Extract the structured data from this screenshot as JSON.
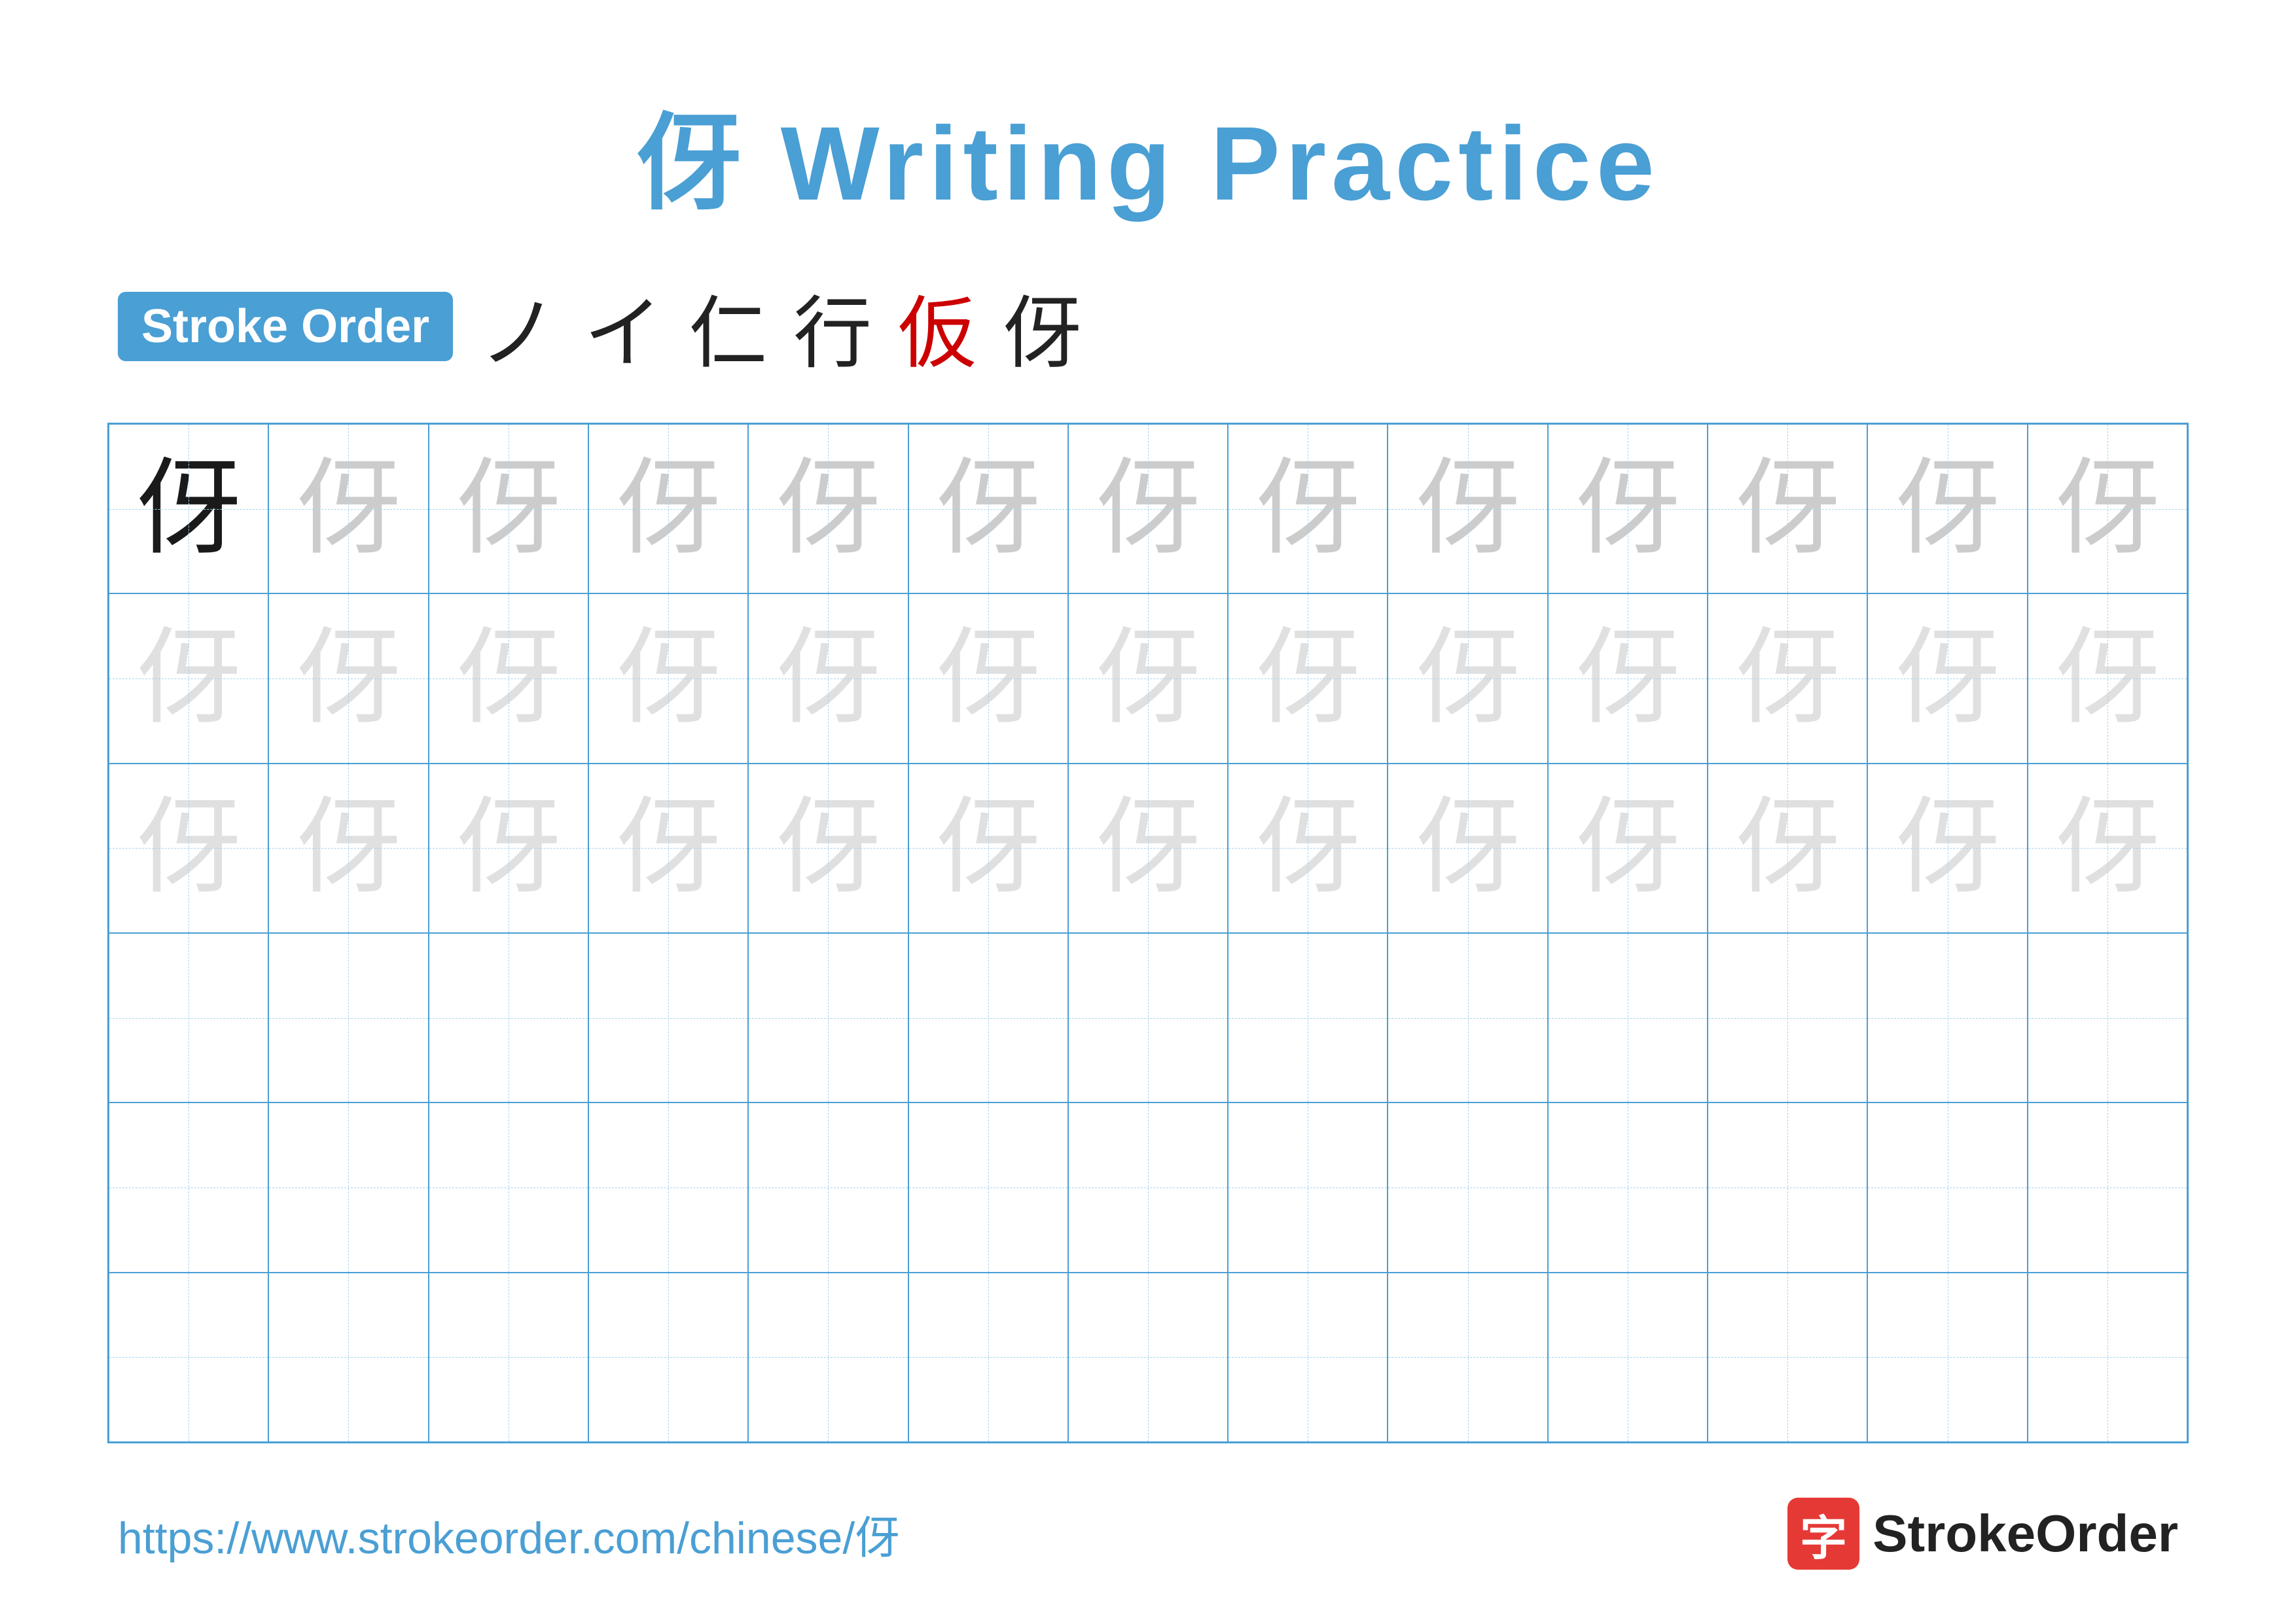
{
  "title": {
    "char": "伢",
    "text": "Writing Practice",
    "full": "伢 Writing Practice"
  },
  "stroke_order": {
    "badge_label": "Stroke Order",
    "strokes": [
      "ノ",
      "イ",
      "仁",
      "行",
      "仮",
      "伢"
    ]
  },
  "grid": {
    "rows": 6,
    "cols": 13,
    "char": "伢",
    "cells": [
      {
        "row": 0,
        "col": 0,
        "style": "dark"
      },
      {
        "row": 0,
        "col": 1,
        "style": "medium"
      },
      {
        "row": 0,
        "col": 2,
        "style": "medium"
      },
      {
        "row": 0,
        "col": 3,
        "style": "medium"
      },
      {
        "row": 0,
        "col": 4,
        "style": "medium"
      },
      {
        "row": 0,
        "col": 5,
        "style": "medium"
      },
      {
        "row": 0,
        "col": 6,
        "style": "medium"
      },
      {
        "row": 0,
        "col": 7,
        "style": "medium"
      },
      {
        "row": 0,
        "col": 8,
        "style": "medium"
      },
      {
        "row": 0,
        "col": 9,
        "style": "medium"
      },
      {
        "row": 0,
        "col": 10,
        "style": "medium"
      },
      {
        "row": 0,
        "col": 11,
        "style": "medium"
      },
      {
        "row": 0,
        "col": 12,
        "style": "medium"
      },
      {
        "row": 1,
        "col": 0,
        "style": "light"
      },
      {
        "row": 1,
        "col": 1,
        "style": "light"
      },
      {
        "row": 1,
        "col": 2,
        "style": "light"
      },
      {
        "row": 1,
        "col": 3,
        "style": "light"
      },
      {
        "row": 1,
        "col": 4,
        "style": "light"
      },
      {
        "row": 1,
        "col": 5,
        "style": "light"
      },
      {
        "row": 1,
        "col": 6,
        "style": "light"
      },
      {
        "row": 1,
        "col": 7,
        "style": "light"
      },
      {
        "row": 1,
        "col": 8,
        "style": "light"
      },
      {
        "row": 1,
        "col": 9,
        "style": "light"
      },
      {
        "row": 1,
        "col": 10,
        "style": "light"
      },
      {
        "row": 1,
        "col": 11,
        "style": "light"
      },
      {
        "row": 1,
        "col": 12,
        "style": "light"
      },
      {
        "row": 2,
        "col": 0,
        "style": "light"
      },
      {
        "row": 2,
        "col": 1,
        "style": "light"
      },
      {
        "row": 2,
        "col": 2,
        "style": "light"
      },
      {
        "row": 2,
        "col": 3,
        "style": "light"
      },
      {
        "row": 2,
        "col": 4,
        "style": "light"
      },
      {
        "row": 2,
        "col": 5,
        "style": "light"
      },
      {
        "row": 2,
        "col": 6,
        "style": "light"
      },
      {
        "row": 2,
        "col": 7,
        "style": "light"
      },
      {
        "row": 2,
        "col": 8,
        "style": "light"
      },
      {
        "row": 2,
        "col": 9,
        "style": "light"
      },
      {
        "row": 2,
        "col": 10,
        "style": "light"
      },
      {
        "row": 2,
        "col": 11,
        "style": "light"
      },
      {
        "row": 2,
        "col": 12,
        "style": "light"
      }
    ]
  },
  "footer": {
    "url": "https://www.strokeorder.com/chinese/伢",
    "logo_text": "StrokeOrder",
    "logo_char": "字"
  }
}
